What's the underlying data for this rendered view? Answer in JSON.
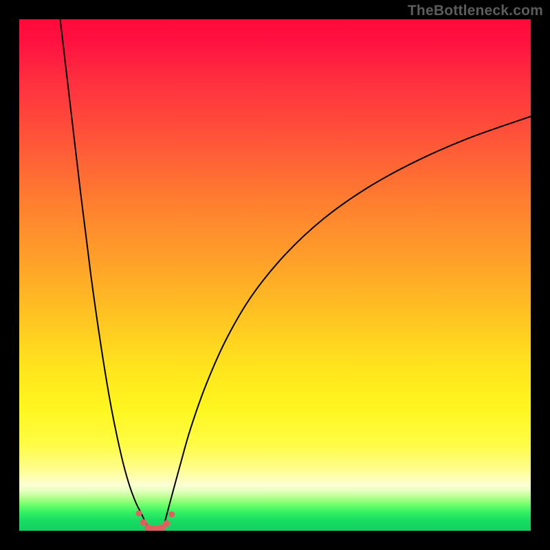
{
  "watermark": "TheBottleneck.com",
  "chart_data": {
    "type": "line",
    "title": "",
    "xlabel": "",
    "ylabel": "",
    "xlim": [
      0,
      100
    ],
    "ylim": [
      0,
      100
    ],
    "series": [
      {
        "name": "left-curve",
        "x": [
          8.0,
          10.0,
          12.0,
          14.0,
          16.0,
          18.0,
          20.0,
          21.5,
          22.8,
          23.8,
          24.6,
          25.5
        ],
        "y": [
          100.0,
          83.0,
          66.0,
          50.0,
          36.0,
          24.0,
          14.5,
          9.0,
          5.5,
          3.5,
          1.8,
          0.0
        ]
      },
      {
        "name": "right-curve",
        "x": [
          28.0,
          28.8,
          30.0,
          31.5,
          33.5,
          36.5,
          40.5,
          45.5,
          52.0,
          59.5,
          68.0,
          77.5,
          88.0,
          100.0
        ],
        "y": [
          0.0,
          3.0,
          7.5,
          13.0,
          20.0,
          28.5,
          37.5,
          46.0,
          54.0,
          61.0,
          67.0,
          72.2,
          76.8,
          81.0
        ]
      }
    ],
    "markers": {
      "name": "bottom-markers",
      "x": [
        23.4,
        24.3,
        25.2,
        26.1,
        27.0,
        27.9,
        28.8,
        29.8
      ],
      "y": [
        3.4,
        1.6,
        0.6,
        0.3,
        0.3,
        0.6,
        1.4,
        3.2
      ],
      "r": [
        4.5,
        5.0,
        5.2,
        5.3,
        5.3,
        5.2,
        5.0,
        4.5
      ]
    },
    "gradient_stops": [
      {
        "pct": 0,
        "color": "#ff0a3a"
      },
      {
        "pct": 25,
        "color": "#ff5a38"
      },
      {
        "pct": 48,
        "color": "#ffa329"
      },
      {
        "pct": 76,
        "color": "#fff61f"
      },
      {
        "pct": 91,
        "color": "#fcffd3"
      },
      {
        "pct": 95,
        "color": "#6cff6a"
      },
      {
        "pct": 100,
        "color": "#12d160"
      }
    ]
  }
}
